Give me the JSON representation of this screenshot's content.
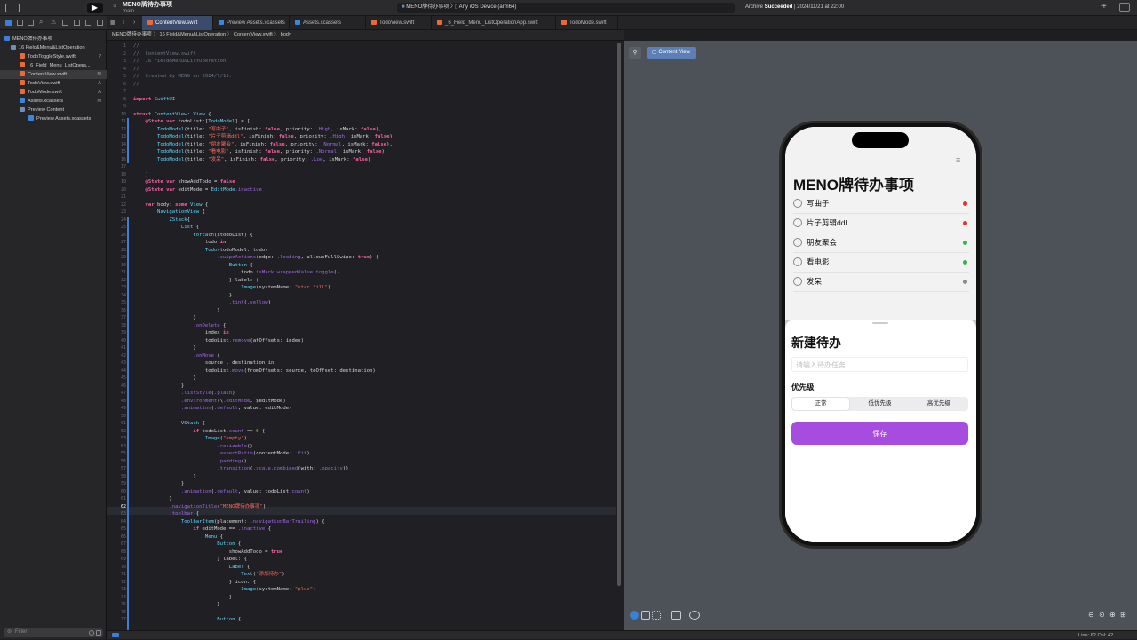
{
  "titlebar": {
    "project_name": "MENO牌待办事项",
    "branch": "main",
    "scheme": "MENO牌待办事项",
    "device": "Any iOS Device (arm64)",
    "status_prefix": "Archive",
    "status_strong": "Succeeded",
    "status_time": "| 2024/11/21 at 22:00"
  },
  "tabs": [
    {
      "label": "ContentView.swift",
      "type": "swift"
    },
    {
      "label": "Preview Assets.xcassets",
      "type": "assets"
    },
    {
      "label": "Assets.xcassets",
      "type": "assets"
    },
    {
      "label": "TodoView.swift",
      "type": "swift"
    },
    {
      "label": "_6_Field_Menu_ListOperationApp.swift",
      "type": "swift"
    },
    {
      "label": "TodoMode.swift",
      "type": "swift"
    }
  ],
  "navigator": {
    "items": [
      {
        "label": "MENO牌待办事项",
        "icon": "project",
        "badge": ""
      },
      {
        "label": "16 Field&Menu&ListOperation",
        "icon": "folder",
        "badge": ""
      },
      {
        "label": "TodoToggleStyle.swift",
        "icon": "swift",
        "badge": "?"
      },
      {
        "label": "_6_Field_Menu_ListOpera...",
        "icon": "swift",
        "badge": ""
      },
      {
        "label": "ContentView.swift",
        "icon": "swift",
        "badge": "M"
      },
      {
        "label": "TodoView.swift",
        "icon": "swift",
        "badge": "A"
      },
      {
        "label": "TodoMode.swift",
        "icon": "swift",
        "badge": "A"
      },
      {
        "label": "Assets.xcassets",
        "icon": "assets",
        "badge": "M"
      },
      {
        "label": "Preview Content",
        "icon": "folder",
        "badge": ""
      },
      {
        "label": "Preview Assets.xcassets",
        "icon": "assets",
        "badge": ""
      }
    ],
    "filter_placeholder": "Filter"
  },
  "jumpbar": {
    "crumbs": [
      "MENO牌待办事项",
      "16 Field&Menu&ListOperation",
      "ContentView.swift",
      "body"
    ]
  },
  "code": {
    "start_line": 1,
    "lines": [
      "//",
      "//  ContentView.swift",
      "//  16 Field&Menu&ListOperation",
      "//",
      "//  Created by MENO on 2024/7/15.",
      "//",
      "",
      "import SwiftUI",
      "",
      "struct ContentView: View {",
      "    @State var todoList:[TodoModel] = [",
      "        TodoModel(title: \"写曲子\", isFinish: false, priority: .High, isMark: false),",
      "        TodoModel(title: \"片子剪辑ddl\", isFinish: false, priority: .High, isMark: false),",
      "        TodoModel(title: \"朋友聚会\", isFinish: false, priority: .Normal, isMark: false),",
      "        TodoModel(title: \"看电影\", isFinish: false, priority: .Normal, isMark: false),",
      "        TodoModel(title: \"发呆\", isFinish: false, priority: .Low, isMark: false)",
      "",
      "    ]",
      "    @State var showAddTodo = false",
      "    @State var editMode = EditMode.inactive",
      "",
      "    var body: some View {",
      "        NavigationView {",
      "            ZStack{",
      "                List {",
      "                    ForEach($todoList) {",
      "                        todo in",
      "                        Todo(todoModel: todo)",
      "                            .swipeActions(edge: .leading, allowsFullSwipe: true) {",
      "                                Button {",
      "                                    todo.isMark.wrappedValue.toggle()",
      "                                } label: {",
      "                                    Image(systemName: \"star.fill\")",
      "                                }",
      "                                .tint(.yellow)",
      "                            }",
      "                    }",
      "                    .onDelete {",
      "                        index in",
      "                        todoList.remove(atOffsets: index)",
      "                    }",
      "                    .onMove {",
      "                        source , destination in",
      "                        todoList.move(fromOffsets: source, toOffset: destination)",
      "                    }",
      "                }",
      "                .listStyle(.plain)",
      "                .environment(\\.editMode, $editMode)",
      "                .animation(.default, value: editMode)",
      "",
      "                VStack {",
      "                    if todoList.count == 0 {",
      "                        Image(\"empty\")",
      "                            .resizable()",
      "                            .aspectRatio(contentMode: .fit)",
      "                            .padding()",
      "                            .transition(.scale.combined(with: .opacity))",
      "                    }",
      "                }",
      "                .animation(.default, value: todoList.count)",
      "            }",
      "            .navigationTitle(\"MENO牌待办事项\")",
      "            .toolbar {",
      "                ToolbarItem(placement: .navigationBarTrailing) {",
      "                    if editMode == .inactive {",
      "                        Menu {",
      "                            Button {",
      "                                showAddTodo = true",
      "                            } label: {",
      "                                Label {",
      "                                    Text(\"添加待办\")",
      "                                } icon: {",
      "                                    Image(systemName: \"plus\")",
      "                                }",
      "                            }",
      "",
      "                            Button {"
    ],
    "current_line": 62
  },
  "preview": {
    "pin_label": "Content View",
    "app": {
      "title": "MENO牌待办事项",
      "todos": [
        {
          "title": "写曲子",
          "color": "#e5332a"
        },
        {
          "title": "片子剪辑ddl",
          "color": "#e5332a"
        },
        {
          "title": "朋友聚会",
          "color": "#2eb84a"
        },
        {
          "title": "看电影",
          "color": "#2eb84a"
        },
        {
          "title": "发呆",
          "color": "#8a8a8a"
        }
      ],
      "sheet": {
        "title": "新建待办",
        "input_placeholder": "请输入待办任务",
        "priority_label": "优先级",
        "segments": [
          "正常",
          "低优先级",
          "高优先级"
        ],
        "selected_segment": 0,
        "save_label": "保存",
        "accent": "#a64de0"
      }
    }
  },
  "status": {
    "position": "Line: 62  Col: 42"
  }
}
